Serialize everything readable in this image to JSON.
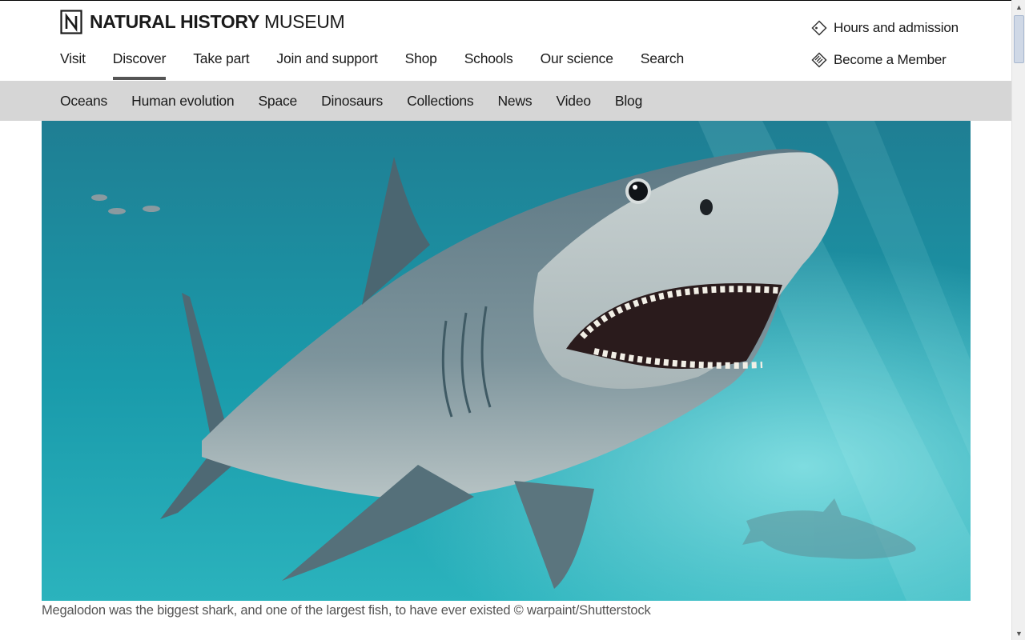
{
  "header": {
    "logo": {
      "bold": "NATURAL HISTORY",
      "light": "MUSEUM",
      "icon": "nhm-n-logo-icon"
    },
    "main_nav": [
      {
        "label": "Visit",
        "active": false
      },
      {
        "label": "Discover",
        "active": true
      },
      {
        "label": "Take part",
        "active": false
      },
      {
        "label": "Join and support",
        "active": false
      },
      {
        "label": "Shop",
        "active": false
      },
      {
        "label": "Schools",
        "active": false
      },
      {
        "label": "Our science",
        "active": false
      },
      {
        "label": "Search",
        "active": false
      }
    ],
    "utility": {
      "hours": {
        "label": "Hours and admission",
        "icon": "ticket-icon"
      },
      "member": {
        "label": "Become a Member",
        "icon": "membership-card-icon"
      }
    }
  },
  "subnav": [
    {
      "label": "Oceans"
    },
    {
      "label": "Human evolution"
    },
    {
      "label": "Space"
    },
    {
      "label": "Dinosaurs"
    },
    {
      "label": "Collections"
    },
    {
      "label": "News"
    },
    {
      "label": "Video"
    },
    {
      "label": "Blog"
    }
  ],
  "hero": {
    "caption": "Megalodon was the biggest shark, and one of the largest fish, to have ever existed © warpaint/Shutterstock"
  },
  "colors": {
    "subnav_bg": "#d6d6d6",
    "active_underline": "#555555",
    "water": "#1a8fa3"
  }
}
